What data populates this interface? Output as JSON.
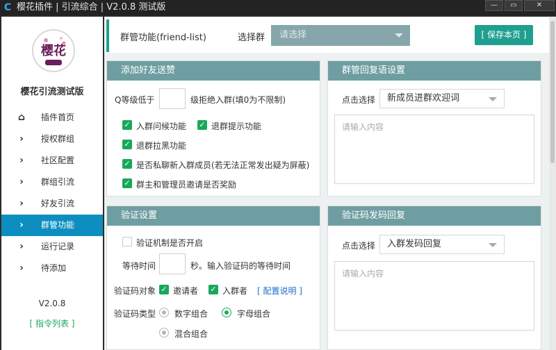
{
  "window": {
    "title": "樱花插件 | 引流综合 | V2.0.8 测试版",
    "logo_glyph": "C",
    "min_glyph": "—",
    "max_glyph": "▭",
    "close_glyph": "✕"
  },
  "sidebar": {
    "app_name": "樱花引流测试版",
    "avatar_text": "樱花",
    "items": [
      {
        "label": "插件首页",
        "icon": "home-icon",
        "glyph": "⌂"
      },
      {
        "label": "授权群组",
        "icon": "chevron-right-icon",
        "glyph": "›"
      },
      {
        "label": "社区配置",
        "icon": "chevron-right-icon",
        "glyph": "›"
      },
      {
        "label": "群组引流",
        "icon": "chevron-right-icon",
        "glyph": "›"
      },
      {
        "label": "好友引流",
        "icon": "chevron-right-icon",
        "glyph": "›"
      },
      {
        "label": "群管功能",
        "icon": "chevron-right-icon",
        "glyph": "›",
        "active": true
      },
      {
        "label": "运行记录",
        "icon": "chevron-right-icon",
        "glyph": "›"
      },
      {
        "label": "待添加",
        "icon": "chevron-right-icon",
        "glyph": "›"
      }
    ],
    "version": "V2.0.8",
    "command_list": "[ 指令列表 ]"
  },
  "header": {
    "page_title": "群管功能(friend-list)",
    "select_label": "选择群",
    "select_placeholder": "请选择",
    "save_button": "[ 保存本页 ]"
  },
  "panel_add_friend": {
    "title": "添加好友送赞",
    "qlevel_prefix": "Q等级低于",
    "qlevel_value": "",
    "qlevel_suffix": "级拒绝入群(填0为不限制)",
    "checkboxes": [
      {
        "label": "入群问候功能",
        "checked": true
      },
      {
        "label": "退群提示功能",
        "checked": true
      },
      {
        "label": "退群拉黑功能",
        "checked": true
      },
      {
        "label": "是否私聊新入群成员(若无法正常发出疑为屏蔽)",
        "checked": true
      },
      {
        "label": "群主和管理员邀请是否奖励",
        "checked": true
      }
    ]
  },
  "panel_group_reply": {
    "title": "群管回复语设置",
    "select_label": "点击选择",
    "selected": "新成员进群欢迎词",
    "placeholder": "请输入内容"
  },
  "panel_verify": {
    "title": "验证设置",
    "enable_label": "验证机制是否开启",
    "enable_checked": false,
    "wait_label": "等待时间",
    "wait_value": "",
    "wait_suffix": "秒。输入验证码的等待时间",
    "target_label": "验证码对象",
    "target_inviter": "邀请者",
    "target_joiner": "入群者",
    "config_link": "[ 配置说明 ]",
    "type_label": "验证码类型",
    "type_options": [
      "数字组合",
      "字母组合",
      "混合组合"
    ],
    "type_selected": "字母组合"
  },
  "panel_code_reply": {
    "title": "验证码发码回复",
    "select_label": "点击选择",
    "selected": "入群发码回复",
    "placeholder": "请输入内容"
  },
  "colors": {
    "accent": "#1f9f8f",
    "active_nav": "#0d8ec0",
    "panel_header": "#6f9ea2",
    "check_green": "#19a85a"
  }
}
